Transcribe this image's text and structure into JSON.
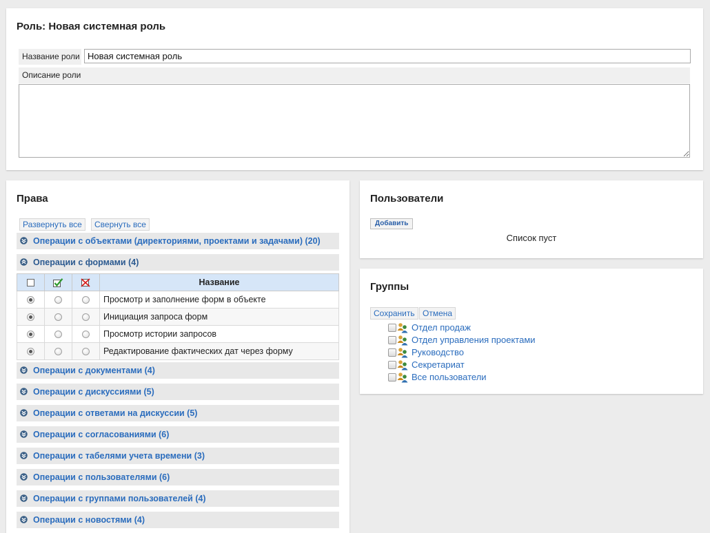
{
  "role": {
    "title": "Роль: Новая системная роль",
    "name_label": "Название роли",
    "name_value": "Новая системная роль",
    "description_label": "Описание роли",
    "description_value": ""
  },
  "rights": {
    "title": "Права",
    "expand_all": "Развернуть все",
    "collapse_all": "Свернуть все",
    "groups": [
      {
        "label": "Операции с объектами (директориями, проектами и задачами) (20)",
        "expanded": false
      },
      {
        "label": "Операции с формами (4)",
        "expanded": true
      },
      {
        "label": "Операции с документами (4)",
        "expanded": false
      },
      {
        "label": "Операции с дискуссиями (5)",
        "expanded": false
      },
      {
        "label": "Операции с ответами на дискуссии (5)",
        "expanded": false
      },
      {
        "label": "Операции с согласованиями (6)",
        "expanded": false
      },
      {
        "label": "Операции с табелями учета времени (3)",
        "expanded": false
      },
      {
        "label": "Операции с пользователями (6)",
        "expanded": false
      },
      {
        "label": "Операции с группами пользователей (4)",
        "expanded": false
      },
      {
        "label": "Операции с новостями (4)",
        "expanded": false
      }
    ],
    "table": {
      "name_header": "Название",
      "rows": [
        {
          "name": "Просмотр и заполнение форм в объекте",
          "selected": "none"
        },
        {
          "name": "Инициация запроса форм",
          "selected": "none"
        },
        {
          "name": "Просмотр истории запросов",
          "selected": "none"
        },
        {
          "name": "Редактирование фактических дат через форму",
          "selected": "none"
        }
      ]
    }
  },
  "users": {
    "title": "Пользователи",
    "add_label": "Добавить",
    "empty_text": "Список пуст"
  },
  "groups": {
    "title": "Группы",
    "save_label": "Сохранить",
    "cancel_label": "Отмена",
    "items": [
      {
        "label": "Отдел продаж",
        "checked": false
      },
      {
        "label": "Отдел управления проектами",
        "checked": false
      },
      {
        "label": "Руководство",
        "checked": false
      },
      {
        "label": "Секретариат",
        "checked": false
      },
      {
        "label": "Все пользователи",
        "checked": false
      }
    ]
  },
  "colors": {
    "link": "#2a6cbd",
    "table_header_bg": "#d6e6f8",
    "group_row_bg": "#e8e8e8",
    "page_bg": "#ececec",
    "allow_icon": "#2e9a2e",
    "deny_icon": "#d62020"
  },
  "icons": {
    "group_expand": "double-chevron-down-icon",
    "group_collapse": "double-chevron-up-icon",
    "allow": "green-checkmark-icon",
    "deny": "red-cross-icon",
    "user_group": "user-group-icon"
  }
}
